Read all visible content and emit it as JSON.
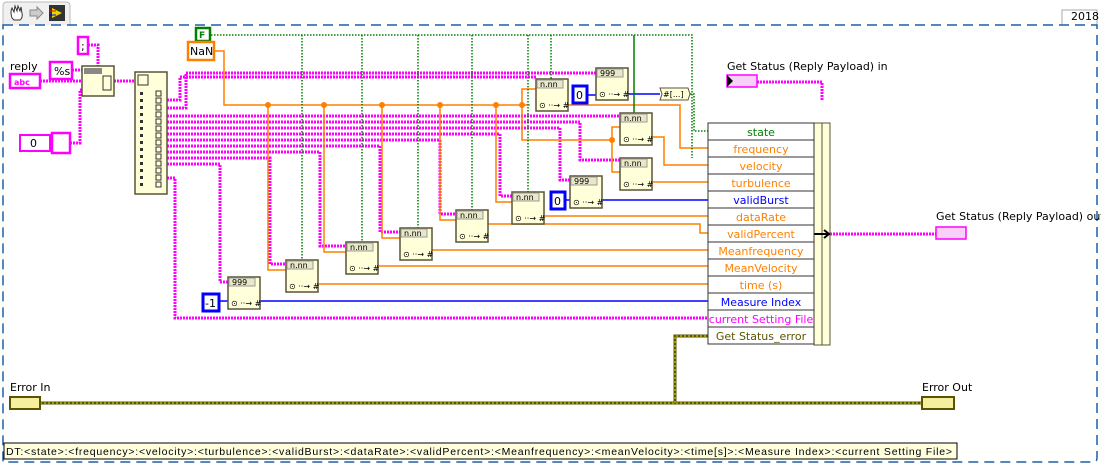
{
  "toolbar": {
    "icons": [
      "hand-icon",
      "arrow-right-icon",
      "vi-icon"
    ]
  },
  "version_tab": "2018",
  "colors": {
    "string_wire": "#ff00ff",
    "double_wire": "#ff8000",
    "integer_wire": "#0000ff",
    "boolean_wire": "#008000",
    "error_wire": "#5a5400",
    "border": "#1f5fa8",
    "node_fill": "#ffffd9"
  },
  "controls": {
    "reply_label": "reply",
    "reply_glyph": "abc",
    "numeric_value": "0",
    "error_in_label": "Error In"
  },
  "constants": {
    "format": "%s",
    "delimiter": ";",
    "bool_false": "F",
    "nan": "NaN",
    "zero_a": "0",
    "zero_b": "0",
    "minus_one": "-1"
  },
  "nodes": {
    "decimal_label": "n.nn",
    "integer_label": "999",
    "array_to_cluster": "#[...]"
  },
  "bundle": {
    "input_label": "Get Status (Reply Payload) in",
    "output_label": "Get Status (Reply Payload) out",
    "fields": [
      {
        "name": "state",
        "color": "#008000"
      },
      {
        "name": "frequency",
        "color": "#ff8000"
      },
      {
        "name": "velocity",
        "color": "#ff8000"
      },
      {
        "name": "turbulence",
        "color": "#ff8000"
      },
      {
        "name": "validBurst",
        "color": "#0000ff"
      },
      {
        "name": "dataRate",
        "color": "#ff8000"
      },
      {
        "name": "validPercent",
        "color": "#ff8000"
      },
      {
        "name": "Meanfrequency",
        "color": "#ff8000"
      },
      {
        "name": "MeanVelocity",
        "color": "#ff8000"
      },
      {
        "name": "time (s)",
        "color": "#ff8000"
      },
      {
        "name": "Measure Index",
        "color": "#0000ff"
      },
      {
        "name": "current Setting File",
        "color": "#ff00ff"
      },
      {
        "name": "Get Status_error",
        "color": "#5a5400"
      }
    ]
  },
  "indicators": {
    "error_out_label": "Error Out"
  },
  "comment": "DT:<state>:<frequency>:<velocity>:<turbulence>:<validBurst>:<dataRate>:<validPercent>:<Meanfrequency>:<meanVelocity>:<time[s]>:<Measure Index>:<current Setting File>"
}
